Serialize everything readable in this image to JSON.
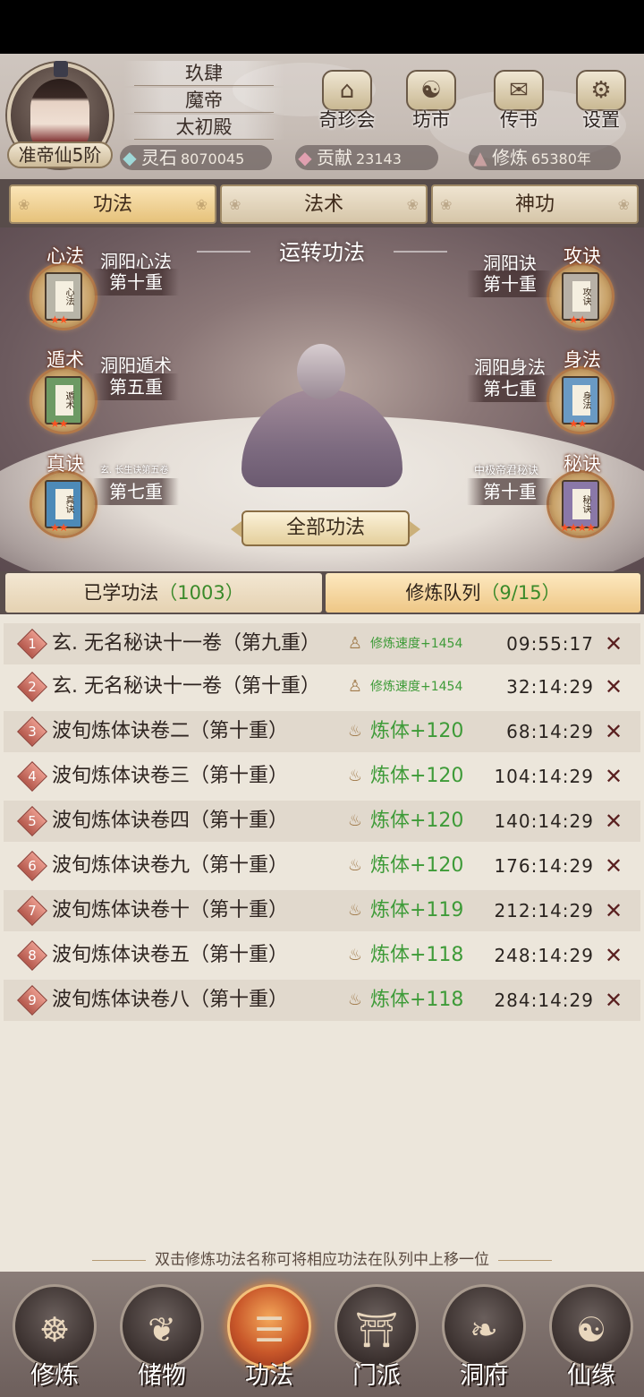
{
  "player": {
    "rank": "准帝仙5阶",
    "name": "玖肆",
    "title": "魔帝",
    "hall": "太初殿"
  },
  "shops": [
    {
      "label": "奇珍会",
      "glyph": "⌂"
    },
    {
      "label": "坊市",
      "glyph": "☯"
    },
    {
      "label": "传书",
      "glyph": "✉"
    },
    {
      "label": "设置",
      "glyph": "⚙"
    }
  ],
  "resources": {
    "spirit_stone": {
      "label": "灵石",
      "value": "8070045"
    },
    "contribution": {
      "label": "贡献",
      "value": "23143"
    },
    "cultivation": {
      "label": "修炼",
      "value": "65380年"
    }
  },
  "tabs": [
    "功法",
    "法术",
    "神功"
  ],
  "stage": {
    "title": "运转功法",
    "all_button": "全部功法",
    "slots": {
      "xinfa": {
        "category": "心法",
        "name": "洞阳心法",
        "level": "第十重",
        "book": "心法"
      },
      "gongjue": {
        "category": "攻诀",
        "name": "洞阳诀",
        "level": "第十重",
        "book": "攻诀"
      },
      "dunshu": {
        "category": "遁术",
        "name": "洞阳遁术",
        "level": "第五重",
        "book": "遁术"
      },
      "shenfa": {
        "category": "身法",
        "name": "洞阳身法",
        "level": "第七重",
        "book": "身法"
      },
      "zhenjue": {
        "category": "真诀",
        "name": "玄. 长生诀第五卷",
        "level": "第七重",
        "book": "真诀"
      },
      "mijue": {
        "category": "秘诀",
        "name": "中极帝君秘诀",
        "level": "第十重",
        "book": "秘诀"
      }
    }
  },
  "subtabs": {
    "learned_label": "已学功法",
    "learned_count": "（1003）",
    "queue_label": "修炼队列",
    "queue_count": "（9/15）"
  },
  "queue": [
    {
      "num": "1",
      "name": "玄. 无名秘诀十一卷（第九重）",
      "effect": "修炼速度+1454",
      "time": "09:55:17"
    },
    {
      "num": "2",
      "name": "玄. 无名秘诀十一卷（第十重）",
      "effect": "修炼速度+1454",
      "time": "32:14:29"
    },
    {
      "num": "3",
      "name": "波旬炼体诀卷二（第十重）",
      "effect": "炼体+120",
      "time": "68:14:29"
    },
    {
      "num": "4",
      "name": "波旬炼体诀卷三（第十重）",
      "effect": "炼体+120",
      "time": "104:14:29"
    },
    {
      "num": "5",
      "name": "波旬炼体诀卷四（第十重）",
      "effect": "炼体+120",
      "time": "140:14:29"
    },
    {
      "num": "6",
      "name": "波旬炼体诀卷九（第十重）",
      "effect": "炼体+120",
      "time": "176:14:29"
    },
    {
      "num": "7",
      "name": "波旬炼体诀卷十（第十重）",
      "effect": "炼体+119",
      "time": "212:14:29"
    },
    {
      "num": "8",
      "name": "波旬炼体诀卷五（第十重）",
      "effect": "炼体+118",
      "time": "248:14:29"
    },
    {
      "num": "9",
      "name": "波旬炼体诀卷八（第十重）",
      "effect": "炼体+118",
      "time": "284:14:29"
    }
  ],
  "hint": "双击修炼功法名称可将相应功法在队列中上移一位",
  "nav": [
    {
      "label": "修炼",
      "glyph": "☸"
    },
    {
      "label": "储物",
      "glyph": "❦"
    },
    {
      "label": "功法",
      "glyph": "☰"
    },
    {
      "label": "门派",
      "glyph": "⛩"
    },
    {
      "label": "洞府",
      "glyph": "❧"
    },
    {
      "label": "仙缘",
      "glyph": "☯"
    }
  ],
  "colors": {
    "effect_green": "#3e9b38",
    "active_tab": "#e6c27b",
    "star": "#ff5020"
  }
}
